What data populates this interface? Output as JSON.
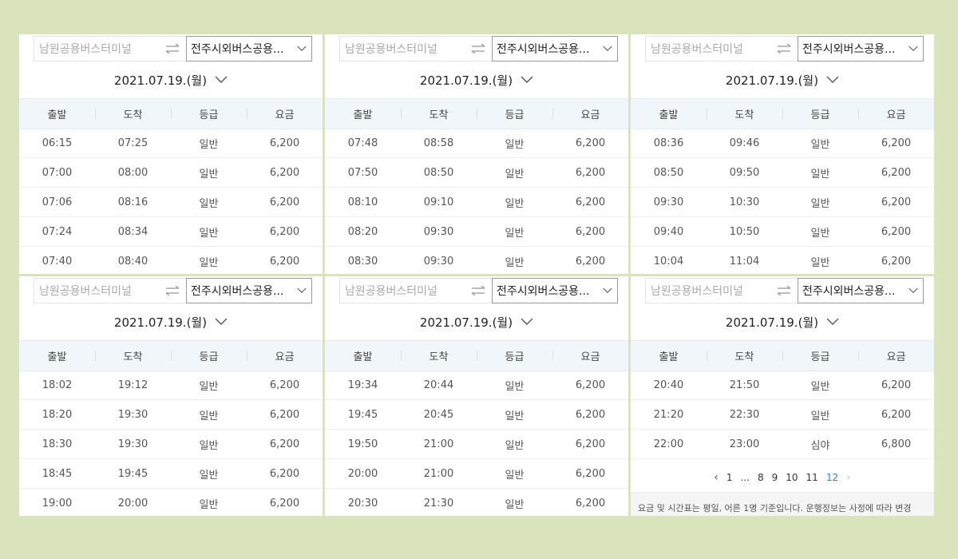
{
  "panels": [
    {
      "from_placeholder": "남원공용버스터미널",
      "to_value": "전주시외버스공용...",
      "date": "2021.07.19.(월)",
      "headers": [
        "출발",
        "도착",
        "등급",
        "요금"
      ],
      "rows": [
        [
          "06:15",
          "07:25",
          "일반",
          "6,200"
        ],
        [
          "07:00",
          "08:00",
          "일반",
          "6,200"
        ],
        [
          "07:06",
          "08:16",
          "일반",
          "6,200"
        ],
        [
          "07:24",
          "08:34",
          "일반",
          "6,200"
        ],
        [
          "07:40",
          "08:40",
          "일반",
          "6,200"
        ]
      ]
    },
    {
      "from_placeholder": "남원공용버스터미널",
      "to_value": "전주시외버스공용...",
      "date": "2021.07.19.(월)",
      "headers": [
        "출발",
        "도착",
        "등급",
        "요금"
      ],
      "rows": [
        [
          "07:48",
          "08:58",
          "일반",
          "6,200"
        ],
        [
          "07:50",
          "08:50",
          "일반",
          "6,200"
        ],
        [
          "08:10",
          "09:10",
          "일반",
          "6,200"
        ],
        [
          "08:20",
          "09:30",
          "일반",
          "6,200"
        ],
        [
          "08:30",
          "09:30",
          "일반",
          "6,200"
        ]
      ]
    },
    {
      "from_placeholder": "남원공용버스터미널",
      "to_value": "전주시외버스공용...",
      "date": "2021.07.19.(월)",
      "headers": [
        "출발",
        "도착",
        "등급",
        "요금"
      ],
      "rows": [
        [
          "08:36",
          "09:46",
          "일반",
          "6,200"
        ],
        [
          "08:50",
          "09:50",
          "일반",
          "6,200"
        ],
        [
          "09:30",
          "10:30",
          "일반",
          "6,200"
        ],
        [
          "09:40",
          "10:50",
          "일반",
          "6,200"
        ],
        [
          "10:04",
          "11:04",
          "일반",
          "6,200"
        ]
      ]
    },
    {
      "from_placeholder": "남원공용버스터미널",
      "to_value": "전주시외버스공용...",
      "date": "2021.07.19.(월)",
      "headers": [
        "출발",
        "도착",
        "등급",
        "요금"
      ],
      "rows": [
        [
          "18:02",
          "19:12",
          "일반",
          "6,200"
        ],
        [
          "18:20",
          "19:30",
          "일반",
          "6,200"
        ],
        [
          "18:30",
          "19:30",
          "일반",
          "6,200"
        ],
        [
          "18:45",
          "19:45",
          "일반",
          "6,200"
        ],
        [
          "19:00",
          "20:00",
          "일반",
          "6,200"
        ]
      ]
    },
    {
      "from_placeholder": "남원공용버스터미널",
      "to_value": "전주시외버스공용...",
      "date": "2021.07.19.(월)",
      "headers": [
        "출발",
        "도착",
        "등급",
        "요금"
      ],
      "rows": [
        [
          "19:34",
          "20:44",
          "일반",
          "6,200"
        ],
        [
          "19:45",
          "20:45",
          "일반",
          "6,200"
        ],
        [
          "19:50",
          "21:00",
          "일반",
          "6,200"
        ],
        [
          "20:00",
          "21:00",
          "일반",
          "6,200"
        ],
        [
          "20:30",
          "21:30",
          "일반",
          "6,200"
        ]
      ]
    },
    {
      "from_placeholder": "남원공용버스터미널",
      "to_value": "전주시외버스공용...",
      "date": "2021.07.19.(월)",
      "headers": [
        "출발",
        "도착",
        "등급",
        "요금"
      ],
      "rows": [
        [
          "20:40",
          "21:50",
          "일반",
          "6,200"
        ],
        [
          "21:20",
          "22:30",
          "일반",
          "6,200"
        ],
        [
          "22:00",
          "23:00",
          "심야",
          "6,800"
        ]
      ],
      "pagination": {
        "prev_icon": "chevron-left-icon",
        "next_icon": "chevron-right-icon",
        "pages": [
          "1",
          "...",
          "8",
          "9",
          "10",
          "11",
          "12"
        ],
        "current": "12"
      },
      "notice": "요금 및 시간표는 평일, 어른 1명 기준입니다. 운행정보는 사정에 따라 변경"
    }
  ],
  "icons": {
    "swap": "swap-arrows-icon",
    "dropdown": "chevron-down-icon"
  },
  "colors": {
    "background": "#d9e4bd",
    "header_bg": "#f1f6fa",
    "active_page": "#2a7fd4"
  }
}
